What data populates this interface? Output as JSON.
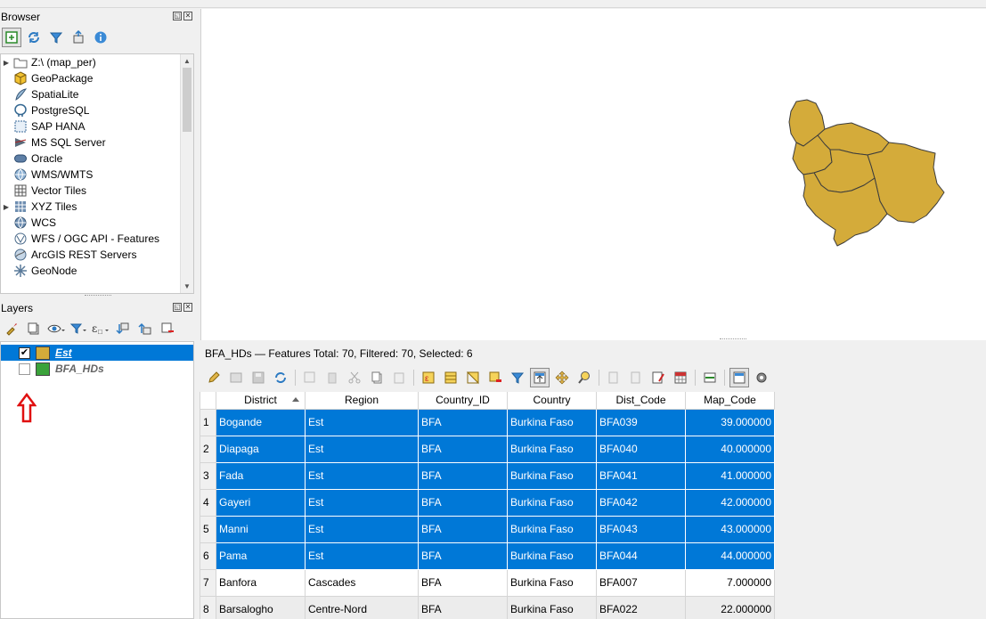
{
  "browser": {
    "title": "Browser",
    "items": [
      {
        "label": "Z:\\ (map_per)",
        "icon": "folder-icon",
        "expandable": true
      },
      {
        "label": "GeoPackage",
        "icon": "geopackage-icon",
        "expandable": false
      },
      {
        "label": "SpatiaLite",
        "icon": "spatialite-icon",
        "expandable": false
      },
      {
        "label": "PostgreSQL",
        "icon": "postgresql-icon",
        "expandable": false
      },
      {
        "label": "SAP HANA",
        "icon": "sap-hana-icon",
        "expandable": false
      },
      {
        "label": "MS SQL Server",
        "icon": "mssql-icon",
        "expandable": false
      },
      {
        "label": "Oracle",
        "icon": "oracle-icon",
        "expandable": false
      },
      {
        "label": "WMS/WMTS",
        "icon": "wms-icon",
        "expandable": false
      },
      {
        "label": "Vector Tiles",
        "icon": "vector-tiles-icon",
        "expandable": false
      },
      {
        "label": "XYZ Tiles",
        "icon": "xyz-tiles-icon",
        "expandable": true
      },
      {
        "label": "WCS",
        "icon": "wcs-icon",
        "expandable": false
      },
      {
        "label": "WFS / OGC API - Features",
        "icon": "wfs-icon",
        "expandable": false
      },
      {
        "label": "ArcGIS REST Servers",
        "icon": "arcgis-icon",
        "expandable": false
      },
      {
        "label": "GeoNode",
        "icon": "geonode-icon",
        "expandable": false
      }
    ]
  },
  "layers": {
    "title": "Layers",
    "items": [
      {
        "name": "Est",
        "checked": true,
        "selected": true,
        "color": "#d4ab3a"
      },
      {
        "name": "BFA_HDs",
        "checked": false,
        "selected": false,
        "color": "#3aa23a"
      }
    ]
  },
  "map": {
    "polygon_fill": "#d4ab3a",
    "polygon_stroke": "#3c3c3c"
  },
  "attribute_table": {
    "title": "BFA_HDs — Features Total: 70, Filtered: 70, Selected: 6",
    "columns": [
      "District",
      "Region",
      "Country_ID",
      "Country",
      "Dist_Code",
      "Map_Code"
    ],
    "rows": [
      {
        "n": "1",
        "selected": true,
        "cells": [
          "Bogande",
          "Est",
          "BFA",
          "Burkina Faso",
          "BFA039",
          "39.000000"
        ]
      },
      {
        "n": "2",
        "selected": true,
        "cells": [
          "Diapaga",
          "Est",
          "BFA",
          "Burkina Faso",
          "BFA040",
          "40.000000"
        ]
      },
      {
        "n": "3",
        "selected": true,
        "cells": [
          "Fada",
          "Est",
          "BFA",
          "Burkina Faso",
          "BFA041",
          "41.000000"
        ]
      },
      {
        "n": "4",
        "selected": true,
        "cells": [
          "Gayeri",
          "Est",
          "BFA",
          "Burkina Faso",
          "BFA042",
          "42.000000"
        ]
      },
      {
        "n": "5",
        "selected": true,
        "cells": [
          "Manni",
          "Est",
          "BFA",
          "Burkina Faso",
          "BFA043",
          "43.000000"
        ]
      },
      {
        "n": "6",
        "selected": true,
        "cells": [
          "Pama",
          "Est",
          "BFA",
          "Burkina Faso",
          "BFA044",
          "44.000000"
        ]
      },
      {
        "n": "7",
        "selected": false,
        "cells": [
          "Banfora",
          "Cascades",
          "BFA",
          "Burkina Faso",
          "BFA007",
          "7.000000"
        ]
      },
      {
        "n": "8",
        "selected": false,
        "cells": [
          "Barsalogho",
          "Centre-Nord",
          "BFA",
          "Burkina Faso",
          "BFA022",
          "22.000000"
        ]
      }
    ]
  },
  "colors": {
    "selection": "#0078d7",
    "annotation_arrow": "#e01010"
  }
}
